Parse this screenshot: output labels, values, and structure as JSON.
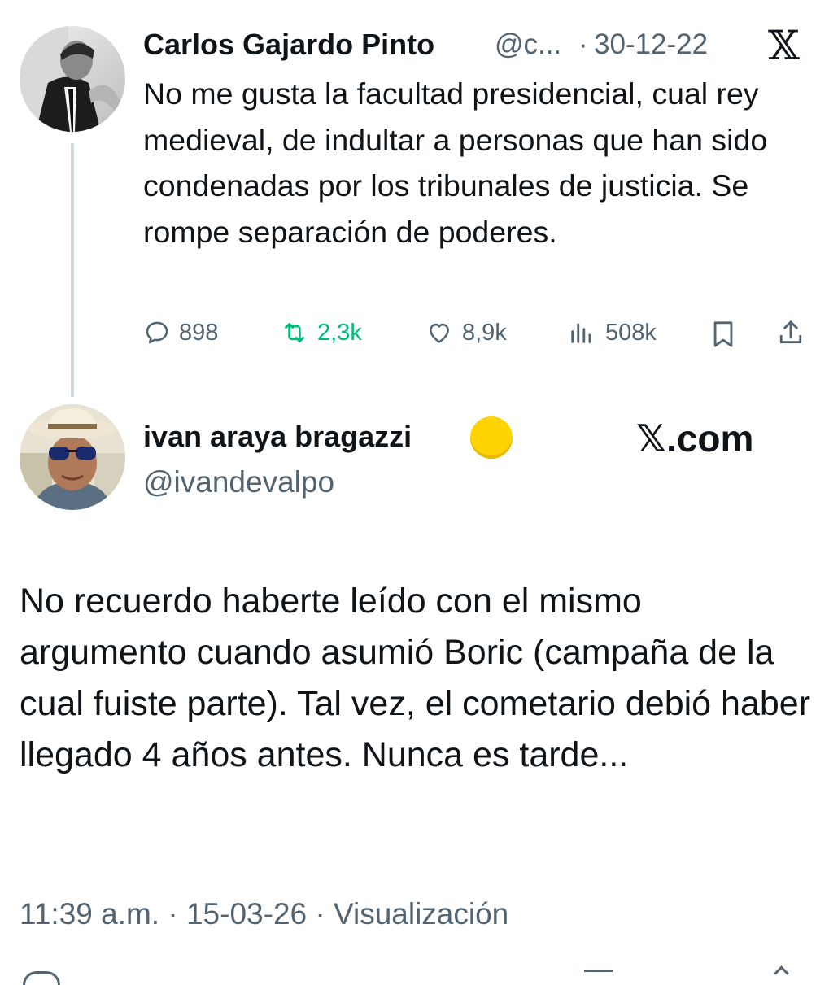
{
  "original_tweet": {
    "author_name": "Carlos Gajardo Pinto",
    "handle": "@c...",
    "separator": "·",
    "date": "30-12-22",
    "text": "No me gusta la facultad presidencial, cual rey medieval, de indultar a personas que han sido condenadas por los tribunales de justicia. Se rompe separación de poderes.",
    "actions": {
      "replies": "898",
      "retweets": "2,3k",
      "likes": "8,9k",
      "views": "508k"
    },
    "retweet_color": "#00ba7c"
  },
  "reply_tweet": {
    "author_name": "ivan araya bragazzi",
    "badge_emoji": "🟡",
    "handle": "@ivandevalpo",
    "watermark": "𝕏.com",
    "text": "No recuerdo haberte leído con el mismo argumento cuando asumió Boric (campaña de la cual fuiste parte). Tal vez, el cometario debió haber llegado 4 años antes. Nunca es tarde...",
    "time": "11:39 a.m.",
    "date": "15-03-26",
    "separator": "·",
    "views_label": "Visualización"
  },
  "theme": {
    "text": "#0f1419",
    "muted": "#536471",
    "thread_line": "#cfd9de",
    "background": "#ffffff"
  },
  "icons": {
    "x_logo": "𝕏"
  }
}
